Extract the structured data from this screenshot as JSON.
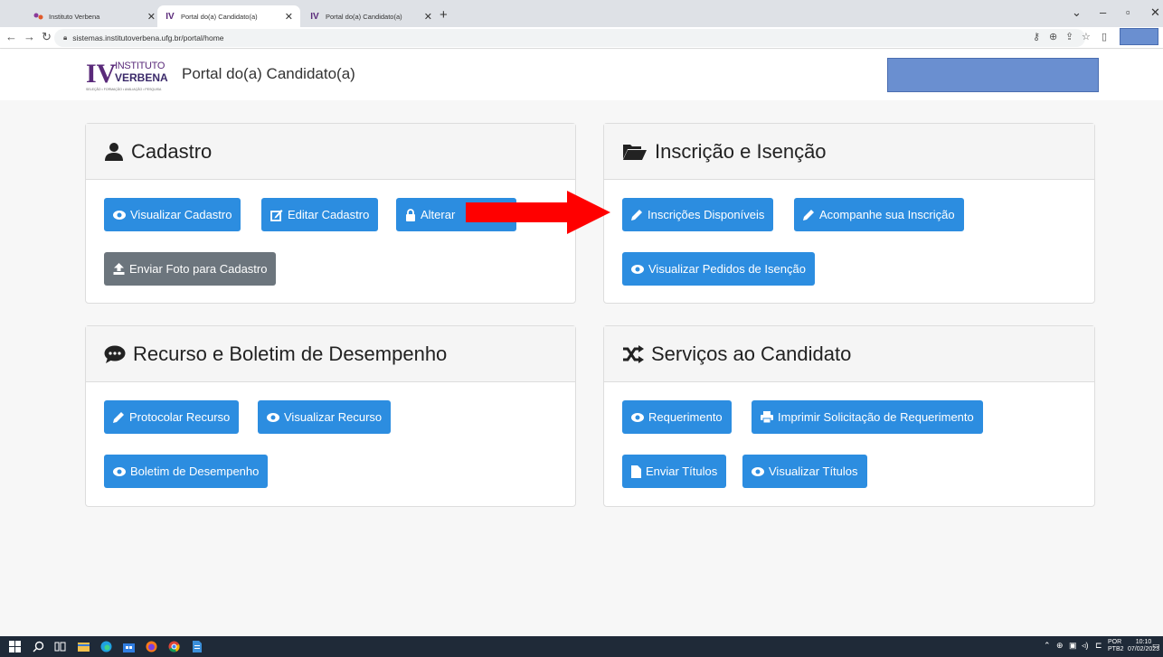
{
  "browser": {
    "tabs": [
      {
        "label": "Instituto Verbena",
        "active": false
      },
      {
        "label": "Portal do(a) Candidato(a)",
        "active": true
      },
      {
        "label": "Portal do(a) Candidato(a)",
        "active": false
      }
    ],
    "url": "sistemas.institutoverbena.ufg.br/portal/home"
  },
  "header": {
    "logo_iv": "IV",
    "logo_top": "INSTITUTO",
    "logo_bottom": "VERBENA",
    "logo_tagline": "SELEÇÃO • FORMAÇÃO • AVALIAÇÃO • PESQUISA",
    "title": "Portal do(a) Candidato(a)"
  },
  "cards": {
    "cadastro": {
      "title": "Cadastro",
      "buttons": [
        "Visualizar Cadastro",
        "Editar Cadastro",
        "Alterar",
        "Enviar Foto para Cadastro"
      ]
    },
    "inscricao": {
      "title": "Inscrição e Isenção",
      "buttons": [
        "Inscrições Disponíveis",
        "Acompanhe sua Inscrição",
        "Visualizar Pedidos de Isenção"
      ]
    },
    "recurso": {
      "title": "Recurso e Boletim de Desempenho",
      "buttons": [
        "Protocolar Recurso",
        "Visualizar Recurso",
        "Boletim de Desempenho"
      ]
    },
    "servicos": {
      "title": "Serviços ao Candidato",
      "buttons": [
        "Requerimento",
        "Imprimir Solicitação de Requerimento",
        "Enviar Títulos",
        "Visualizar Títulos"
      ]
    }
  },
  "taskbar": {
    "lang_top": "POR",
    "lang_bottom": "PTB2",
    "time": "10:10",
    "date": "07/02/2023"
  },
  "colors": {
    "primary": "#2c8de0",
    "secondary": "#6c757d",
    "arrow": "#ff0000",
    "redacted": "#6a8fd0"
  }
}
